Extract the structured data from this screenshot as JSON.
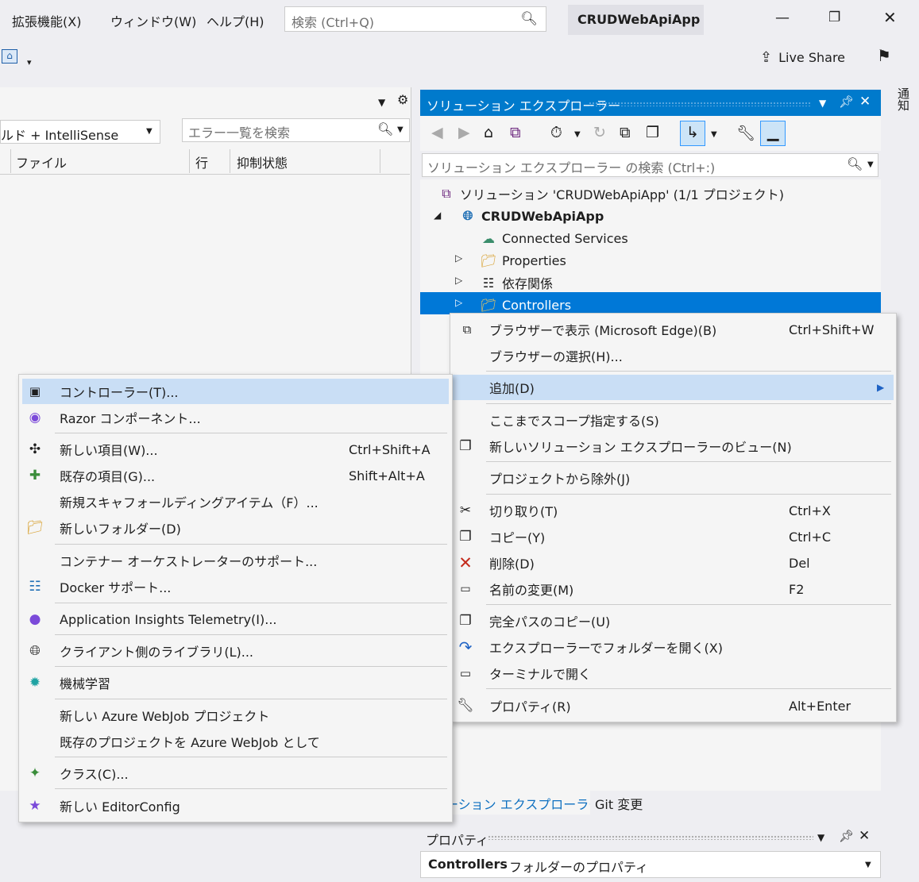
{
  "menubar": {
    "items": [
      "拡張機能(X)",
      "ウィンドウ(W)",
      "ヘルプ(H)"
    ]
  },
  "global_search": {
    "placeholder": "検索 (Ctrl+Q)"
  },
  "app_title": "CRUDWebApiApp",
  "live_share": "Live Share",
  "side_vertical_tab": "通知",
  "error_list": {
    "build_filter": "ルド + IntelliSense",
    "search_placeholder": "エラー一覧を検索",
    "columns": [
      "ファイル",
      "行",
      "抑制状態"
    ]
  },
  "solution_explorer": {
    "title": "ソリューション エクスプローラー",
    "search_placeholder": "ソリューション エクスプローラー の検索 (Ctrl+:)",
    "tree": [
      {
        "label": "ソリューション 'CRUDWebApiApp' (1/1 プロジェクト)",
        "icon": "solution-icon"
      },
      {
        "label": "CRUDWebApiApp",
        "icon": "web-project-icon"
      },
      {
        "label": "Connected Services",
        "icon": "connected-services-icon"
      },
      {
        "label": "Properties",
        "icon": "folder-wrench-icon"
      },
      {
        "label": "依存関係",
        "icon": "dependencies-icon"
      },
      {
        "label": "Controllers",
        "icon": "folder-icon"
      }
    ]
  },
  "context_menu": {
    "items": [
      {
        "label": "ブラウザーで表示 (Microsoft Edge)(B)",
        "shortcut": "Ctrl+Shift+W",
        "icon": "browser-icon"
      },
      {
        "label": "ブラウザーの選択(H)...",
        "shortcut": ""
      },
      {
        "label": "追加(D)",
        "shortcut": "",
        "icon": "submenu-arrow-icon"
      },
      {
        "label": "ここまでスコープ指定する(S)",
        "shortcut": ""
      },
      {
        "label": "新しいソリューション エクスプローラーのビュー(N)",
        "shortcut": "",
        "icon": "new-view-icon"
      },
      {
        "label": "プロジェクトから除外(J)",
        "shortcut": ""
      },
      {
        "label": "切り取り(T)",
        "shortcut": "Ctrl+X",
        "icon": "cut-icon"
      },
      {
        "label": "コピー(Y)",
        "shortcut": "Ctrl+C",
        "icon": "copy-icon"
      },
      {
        "label": "削除(D)",
        "shortcut": "Del",
        "icon": "delete-icon"
      },
      {
        "label": "名前の変更(M)",
        "shortcut": "F2",
        "icon": "rename-icon"
      },
      {
        "label": "完全パスのコピー(U)",
        "shortcut": "",
        "icon": "copy-path-icon"
      },
      {
        "label": "エクスプローラーでフォルダーを開く(X)",
        "shortcut": "",
        "icon": "open-folder-icon"
      },
      {
        "label": "ターミナルで開く",
        "shortcut": "",
        "icon": "terminal-icon"
      },
      {
        "label": "プロパティ(R)",
        "shortcut": "Alt+Enter",
        "icon": "wrench-icon"
      }
    ]
  },
  "add_submenu": {
    "items": [
      {
        "label": "コントローラー(T)...",
        "shortcut": "",
        "icon": "controller-icon"
      },
      {
        "label": "Razor コンポーネント...",
        "shortcut": "",
        "icon": "razor-icon"
      },
      {
        "label": "新しい項目(W)...",
        "shortcut": "Ctrl+Shift+A",
        "icon": "new-item-icon"
      },
      {
        "label": "既存の項目(G)...",
        "shortcut": "Shift+Alt+A",
        "icon": "existing-item-icon"
      },
      {
        "label": "新規スキャフォールディングアイテム（F）...",
        "shortcut": ""
      },
      {
        "label": "新しいフォルダー(D)",
        "shortcut": "",
        "icon": "new-folder-icon"
      },
      {
        "label": "コンテナー オーケストレーターのサポート...",
        "shortcut": ""
      },
      {
        "label": "Docker サポート...",
        "shortcut": "",
        "icon": "docker-icon"
      },
      {
        "label": "Application Insights Telemetry(I)...",
        "shortcut": "",
        "icon": "app-insights-icon"
      },
      {
        "label": "クライアント側のライブラリ(L)...",
        "shortcut": "",
        "icon": "client-library-icon"
      },
      {
        "label": "機械学習",
        "shortcut": "",
        "icon": "machine-learning-icon"
      },
      {
        "label": "新しい Azure WebJob プロジェクト",
        "shortcut": ""
      },
      {
        "label": "既存のプロジェクトを Azure WebJob として",
        "shortcut": ""
      },
      {
        "label": "クラス(C)...",
        "shortcut": "",
        "icon": "class-icon"
      },
      {
        "label": "新しい EditorConfig",
        "shortcut": "",
        "icon": "editorconfig-icon"
      }
    ]
  },
  "bottom_tabs": [
    "リューション エクスプローラー",
    "Git 変更"
  ],
  "properties_panel": {
    "title": "プロパティ",
    "object_name": "Controllers",
    "object_desc": "フォルダーのプロパティ"
  },
  "colors": {
    "accent": "#007acc",
    "selection": "#0078d7",
    "menu_highlight": "#c9def5",
    "delete_red": "#c42b1c"
  }
}
